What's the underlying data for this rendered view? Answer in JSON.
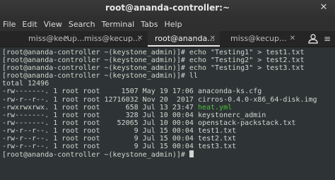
{
  "window": {
    "title": "root@ananda-controller:~"
  },
  "menubar": {
    "items": [
      "File",
      "Edit",
      "View",
      "Search",
      "Terminal",
      "Tabs",
      "Help"
    ]
  },
  "tabs": [
    {
      "label": "miss@kecup...",
      "active": false
    },
    {
      "label": "miss@kecup...",
      "active": false
    },
    {
      "label": "root@ananda...",
      "active": true
    },
    {
      "label": "miss@kecup...",
      "active": false
    }
  ],
  "terminal": {
    "prompt": "[root@ananda-controller ~(keystone_admin)]# ",
    "commands": [
      "echo \"Testing1\" > test1.txt",
      "echo \"Testing2\" > test2.txt",
      "echo \"Testing3\" > test3.txt",
      "ll"
    ],
    "total_line": "total 12496",
    "listing": [
      {
        "perm": "-rw-------.",
        "links": "1",
        "owner": "root",
        "group": "root",
        "size": "1507",
        "month": "May",
        "day": "19",
        "time": "17:06",
        "name": "anaconda-ks.cfg",
        "executable": false
      },
      {
        "perm": "-rw-r--r--.",
        "links": "1",
        "owner": "root",
        "group": "root",
        "size": "12716032",
        "month": "Nov",
        "day": "20",
        "time": "2017",
        "name": "cirros-0.4.0-x86_64-disk.img",
        "executable": false
      },
      {
        "perm": "-rwxrwxrwx.",
        "links": "1",
        "owner": "root",
        "group": "root",
        "size": "658",
        "month": "Jul",
        "day": "13",
        "time": "23:47",
        "name": "heat.yml",
        "executable": true
      },
      {
        "perm": "-rw-------.",
        "links": "1",
        "owner": "root",
        "group": "root",
        "size": "328",
        "month": "Jul",
        "day": "10",
        "time": "00:04",
        "name": "keystonerc_admin",
        "executable": false
      },
      {
        "perm": "-rw-------.",
        "links": "1",
        "owner": "root",
        "group": "root",
        "size": "52065",
        "month": "Jul",
        "day": "10",
        "time": "00:04",
        "name": "openstack-packstack.txt",
        "executable": false
      },
      {
        "perm": "-rw-r--r--.",
        "links": "1",
        "owner": "root",
        "group": "root",
        "size": "9",
        "month": "Jul",
        "day": "15",
        "time": "00:04",
        "name": "test1.txt",
        "executable": false
      },
      {
        "perm": "-rw-r--r--.",
        "links": "1",
        "owner": "root",
        "group": "root",
        "size": "9",
        "month": "Jul",
        "day": "15",
        "time": "00:04",
        "name": "test2.txt",
        "executable": false
      },
      {
        "perm": "-rw-r--r--.",
        "links": "1",
        "owner": "root",
        "group": "root",
        "size": "9",
        "month": "Jul",
        "day": "15",
        "time": "00:04",
        "name": "test3.txt",
        "executable": false
      }
    ]
  },
  "colors": {
    "terminal_bg": "#2e3436",
    "terminal_fg": "#d3d7cf",
    "executable": "#4fbf3a"
  },
  "icons": {
    "close": "close-icon",
    "new_tab": "new-tab-icon",
    "menu": "hamburger-menu-icon"
  }
}
